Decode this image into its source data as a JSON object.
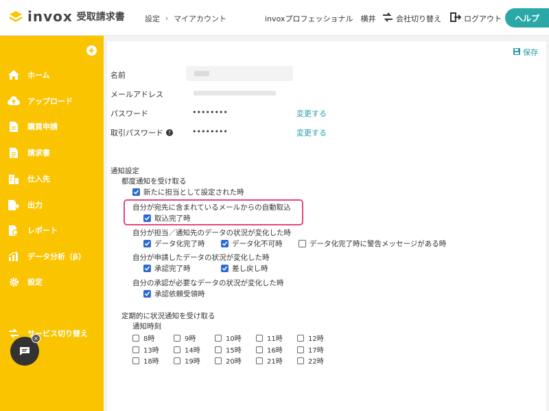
{
  "header": {
    "brand": "invox",
    "product": "受取請求書",
    "breadcrumb": [
      "設定",
      "マイアカウント"
    ],
    "user": "invoxプロフェッショナル　横井",
    "switch_company": "会社切り替え",
    "logout": "ログアウト",
    "help": "ヘルプ"
  },
  "sidebar": {
    "items": [
      {
        "label": "ホーム",
        "icon": "home-icon"
      },
      {
        "label": "アップロード",
        "icon": "cloud-upload-icon"
      },
      {
        "label": "購買申請",
        "icon": "document-icon"
      },
      {
        "label": "請求書",
        "icon": "invoice-icon"
      },
      {
        "label": "仕入先",
        "icon": "building-icon"
      },
      {
        "label": "出力",
        "icon": "export-icon"
      },
      {
        "label": "レポート",
        "icon": "report-icon"
      },
      {
        "label": "データ分析（β）",
        "icon": "chart-icon"
      },
      {
        "label": "設定",
        "icon": "gear-icon"
      }
    ],
    "service_switch": "サービス切り替え"
  },
  "account": {
    "save": "保存",
    "name_label": "名前",
    "email_label": "メールアドレス",
    "password_label": "パスワード",
    "password_value": "••••••••",
    "password_change": "変更する",
    "trade_password_label": "取引パスワード",
    "trade_password_value": "••••••••",
    "trade_password_change": "変更する"
  },
  "notifications": {
    "section_title": "通知設定",
    "each_title": "都度通知を受け取る",
    "new_assignee": "新たに担当として設定された時",
    "auto_import_title": "自分が宛先に含まれているメールからの自動取込",
    "import_done": "取込完了時",
    "data_status_title": "自分が担当／通知先のデータの状況が変化した時",
    "data_done": "データ化完了時",
    "data_failed": "データ化不可時",
    "data_warning": "データ化完了時に警告メッセージがある時",
    "applied_title": "自分が申請したデータの状況が変化した時",
    "approved": "承認完了時",
    "returned": "差し戻し時",
    "approval_title": "自分の承認が必要なデータの状況が変化した時",
    "approval_request": "承認依頼受領時",
    "periodic_title": "定期的に状況通知を受け取る",
    "time_label": "通知時刻",
    "hours": [
      "8時",
      "9時",
      "10時",
      "11時",
      "12時",
      "13時",
      "14時",
      "15時",
      "16時",
      "17時",
      "18時",
      "19時",
      "20時",
      "21時",
      "22時"
    ]
  },
  "colors": {
    "sidebar": "#fbc400",
    "accent": "#2aa8a8",
    "link": "#2aa0b0",
    "checkbox": "#2d6bd1",
    "highlight": "#e9447a"
  }
}
